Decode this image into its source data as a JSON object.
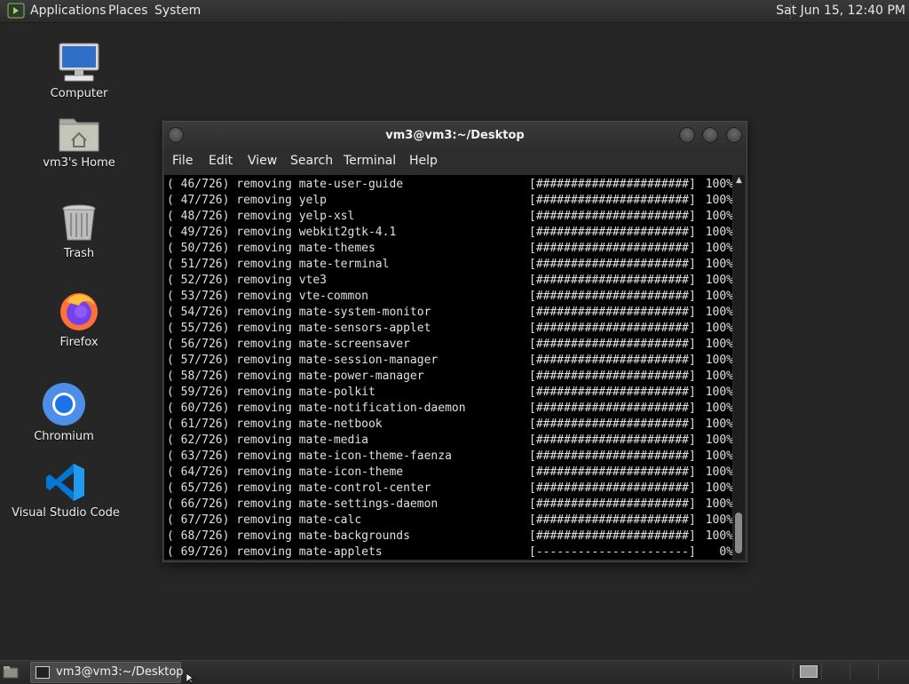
{
  "top_panel": {
    "menus": [
      "Applications",
      "Places",
      "System"
    ],
    "clock": "Sat Jun 15, 12:40 PM"
  },
  "desktop_icons": [
    {
      "label": "Computer",
      "icon": "computer-icon"
    },
    {
      "label": "vm3's Home",
      "icon": "home-folder-icon"
    },
    {
      "label": "Trash",
      "icon": "trash-icon"
    },
    {
      "label": "Firefox",
      "icon": "firefox-icon"
    },
    {
      "label": "Chromium",
      "icon": "chromium-icon"
    },
    {
      "label": "Visual Studio Code",
      "icon": "vscode-icon"
    }
  ],
  "terminal": {
    "title": "vm3@vm3:~/Desktop",
    "menu": [
      "File",
      "Edit",
      "View",
      "Search",
      "Terminal",
      "Help"
    ],
    "lines": [
      {
        "text": "( 46/726) removing mate-user-guide",
        "progress": "[######################]",
        "percent": "100%"
      },
      {
        "text": "( 47/726) removing yelp",
        "progress": "[######################]",
        "percent": "100%"
      },
      {
        "text": "( 48/726) removing yelp-xsl",
        "progress": "[######################]",
        "percent": "100%"
      },
      {
        "text": "( 49/726) removing webkit2gtk-4.1",
        "progress": "[######################]",
        "percent": "100%"
      },
      {
        "text": "( 50/726) removing mate-themes",
        "progress": "[######################]",
        "percent": "100%"
      },
      {
        "text": "( 51/726) removing mate-terminal",
        "progress": "[######################]",
        "percent": "100%"
      },
      {
        "text": "( 52/726) removing vte3",
        "progress": "[######################]",
        "percent": "100%"
      },
      {
        "text": "( 53/726) removing vte-common",
        "progress": "[######################]",
        "percent": "100%"
      },
      {
        "text": "( 54/726) removing mate-system-monitor",
        "progress": "[######################]",
        "percent": "100%"
      },
      {
        "text": "( 55/726) removing mate-sensors-applet",
        "progress": "[######################]",
        "percent": "100%"
      },
      {
        "text": "( 56/726) removing mate-screensaver",
        "progress": "[######################]",
        "percent": "100%"
      },
      {
        "text": "( 57/726) removing mate-session-manager",
        "progress": "[######################]",
        "percent": "100%"
      },
      {
        "text": "( 58/726) removing mate-power-manager",
        "progress": "[######################]",
        "percent": "100%"
      },
      {
        "text": "( 59/726) removing mate-polkit",
        "progress": "[######################]",
        "percent": "100%"
      },
      {
        "text": "( 60/726) removing mate-notification-daemon",
        "progress": "[######################]",
        "percent": "100%"
      },
      {
        "text": "( 61/726) removing mate-netbook",
        "progress": "[######################]",
        "percent": "100%"
      },
      {
        "text": "( 62/726) removing mate-media",
        "progress": "[######################]",
        "percent": "100%"
      },
      {
        "text": "( 63/726) removing mate-icon-theme-faenza",
        "progress": "[######################]",
        "percent": "100%"
      },
      {
        "text": "( 64/726) removing mate-icon-theme",
        "progress": "[######################]",
        "percent": "100%"
      },
      {
        "text": "( 65/726) removing mate-control-center",
        "progress": "[######################]",
        "percent": "100%"
      },
      {
        "text": "( 66/726) removing mate-settings-daemon",
        "progress": "[######################]",
        "percent": "100%"
      },
      {
        "text": "( 67/726) removing mate-calc",
        "progress": "[######################]",
        "percent": "100%"
      },
      {
        "text": "( 68/726) removing mate-backgrounds",
        "progress": "[######################]",
        "percent": "100%"
      },
      {
        "text": "( 69/726) removing mate-applets",
        "progress": "[----------------------]",
        "percent": "0%"
      }
    ]
  },
  "taskbar": {
    "task_label": "vm3@vm3:~/Desktop"
  },
  "colors": {
    "desktop_bg": "#262626",
    "terminal_bg": "#000000",
    "terminal_fg": "#e0e0e0"
  }
}
